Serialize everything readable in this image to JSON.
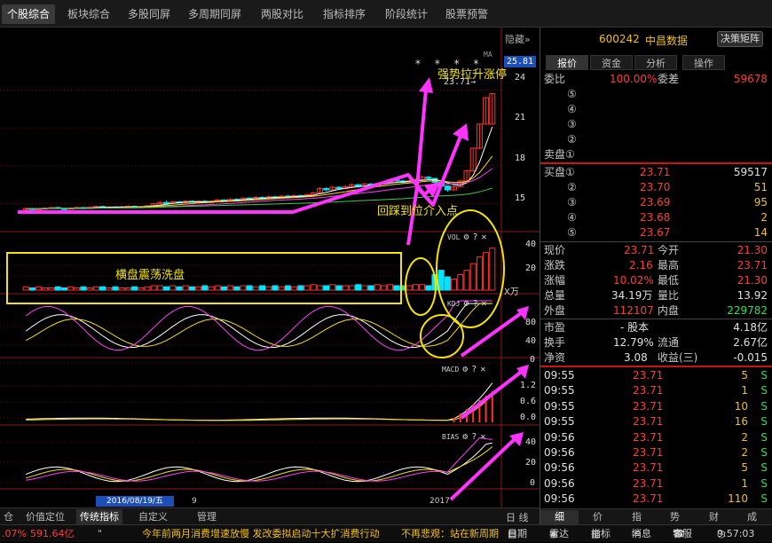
{
  "topnav": {
    "tabs": [
      "个股综合",
      "板块综合",
      "多股同屏",
      "多周期同屏",
      "两股对比",
      "指标排序",
      "阶段统计",
      "股票预警"
    ],
    "active_index": 0
  },
  "chart": {
    "hide_label": "隐藏»",
    "ma_label": "MA",
    "stars": "* * *   *",
    "high_marker": "23.71→",
    "current_price_tag": "25.81",
    "price_axis": [
      "24",
      "21",
      "18",
      "15"
    ],
    "vol_axis": [
      "40",
      "20"
    ],
    "vol_unit": "X万",
    "kdj_axis": [
      "80",
      "40",
      "0"
    ],
    "macd_axis": [
      "1.2",
      "0.6",
      "0.0"
    ],
    "bias_axis": [
      "40",
      "20",
      "0"
    ],
    "indicator_labels": {
      "vol": "VOL",
      "kdj": "KDJ",
      "macd": "MACD",
      "bias": "BIAS"
    },
    "indicator_icons": [
      "⚙",
      "?",
      "✕"
    ],
    "annotations": {
      "strong_rally": "强势拉升涨停",
      "pullback": "回踩到位介入点",
      "consolidation": "横盘震荡洗盘"
    },
    "date_highlight": "2016/08/19/五",
    "date_9": "9",
    "date_2017": "2017",
    "colors": {
      "up": "#ff3232",
      "down": "#00e5ff",
      "arrow": "#ff33ff",
      "annotation": "#f4e500"
    }
  },
  "chart_data": {
    "type": "candlestick",
    "price_ylim": [
      13.5,
      26
    ],
    "candles": [
      [
        14.55,
        14.62,
        14.65,
        14.5
      ],
      [
        14.62,
        14.58,
        14.68,
        14.55
      ],
      [
        14.58,
        14.6,
        14.65,
        14.52
      ],
      [
        14.6,
        14.66,
        14.7,
        14.55
      ],
      [
        14.66,
        14.7,
        14.75,
        14.6
      ],
      [
        14.7,
        14.62,
        14.75,
        14.58
      ],
      [
        14.62,
        14.58,
        14.68,
        14.5
      ],
      [
        14.58,
        14.64,
        14.7,
        14.55
      ],
      [
        14.64,
        14.7,
        14.78,
        14.6
      ],
      [
        14.7,
        14.66,
        14.75,
        14.6
      ],
      [
        14.66,
        14.72,
        14.8,
        14.6
      ],
      [
        14.72,
        14.78,
        14.85,
        14.68
      ],
      [
        14.78,
        14.72,
        14.85,
        14.66
      ],
      [
        14.72,
        14.75,
        14.82,
        14.68
      ],
      [
        14.75,
        14.7,
        14.8,
        14.64
      ],
      [
        14.7,
        14.76,
        14.82,
        14.66
      ],
      [
        14.76,
        14.8,
        14.88,
        14.72
      ],
      [
        14.8,
        14.74,
        14.86,
        14.7
      ],
      [
        14.74,
        14.78,
        14.84,
        14.7
      ],
      [
        14.78,
        14.84,
        14.9,
        14.74
      ],
      [
        14.84,
        15.0,
        15.05,
        14.8
      ],
      [
        15.0,
        15.1,
        15.2,
        14.95
      ],
      [
        15.1,
        15.05,
        15.25,
        15.0
      ],
      [
        15.05,
        15.15,
        15.2,
        15.0
      ],
      [
        15.15,
        15.1,
        15.22,
        15.05
      ],
      [
        15.1,
        15.2,
        15.3,
        15.05
      ],
      [
        15.2,
        15.15,
        15.28,
        15.1
      ],
      [
        15.15,
        15.2,
        15.3,
        15.1
      ],
      [
        15.2,
        15.1,
        15.3,
        15.05
      ],
      [
        15.1,
        15.2,
        15.25,
        15.05
      ],
      [
        15.2,
        15.3,
        15.4,
        15.15
      ],
      [
        15.3,
        15.25,
        15.35,
        15.2
      ],
      [
        15.25,
        15.35,
        15.45,
        15.2
      ],
      [
        15.35,
        15.3,
        15.45,
        15.25
      ],
      [
        15.3,
        15.45,
        15.5,
        15.25
      ],
      [
        15.45,
        15.4,
        15.5,
        15.35
      ],
      [
        15.4,
        15.5,
        15.6,
        15.35
      ],
      [
        15.5,
        15.45,
        15.6,
        15.4
      ],
      [
        15.45,
        15.55,
        15.65,
        15.4
      ],
      [
        15.55,
        15.5,
        15.62,
        15.45
      ],
      [
        15.5,
        15.6,
        15.7,
        15.45
      ],
      [
        15.6,
        15.55,
        15.7,
        15.5
      ],
      [
        15.55,
        15.65,
        15.75,
        15.5
      ],
      [
        15.65,
        15.6,
        15.72,
        15.55
      ],
      [
        15.6,
        15.7,
        15.8,
        15.55
      ],
      [
        15.7,
        15.85,
        15.95,
        15.65
      ],
      [
        15.85,
        16.2,
        16.3,
        15.8
      ],
      [
        16.2,
        16.1,
        16.3,
        16.0
      ],
      [
        16.1,
        16.3,
        16.4,
        16.05
      ],
      [
        16.3,
        16.2,
        16.4,
        16.1
      ],
      [
        16.2,
        16.35,
        16.45,
        16.15
      ],
      [
        16.35,
        16.5,
        16.6,
        16.3
      ],
      [
        16.5,
        16.4,
        16.6,
        16.35
      ],
      [
        16.4,
        16.55,
        16.65,
        16.35
      ],
      [
        16.55,
        16.45,
        16.65,
        16.4
      ],
      [
        16.45,
        16.6,
        16.7,
        16.4
      ],
      [
        16.6,
        16.7,
        16.8,
        16.55
      ],
      [
        16.7,
        16.9,
        17.0,
        16.65
      ],
      [
        16.9,
        16.8,
        17.0,
        16.75
      ],
      [
        16.8,
        16.7,
        16.9,
        16.6
      ],
      [
        16.7,
        16.8,
        16.9,
        16.65
      ],
      [
        16.8,
        16.9,
        17.0,
        16.75
      ],
      [
        16.9,
        17.1,
        17.2,
        16.85
      ],
      [
        17.1,
        17.0,
        17.2,
        16.9
      ],
      [
        17.0,
        16.7,
        17.05,
        16.5
      ],
      [
        16.7,
        16.4,
        16.75,
        16.3
      ],
      [
        16.4,
        16.1,
        16.45,
        15.95
      ],
      [
        16.1,
        16.35,
        16.45,
        16.0
      ],
      [
        16.35,
        16.8,
        16.9,
        16.3
      ],
      [
        16.8,
        17.6,
        17.7,
        16.75
      ],
      [
        17.6,
        19.4,
        19.4,
        17.55
      ],
      [
        19.4,
        21.3,
        21.3,
        19.3
      ],
      [
        21.3,
        23.4,
        23.4,
        21.3
      ],
      [
        21.3,
        23.71,
        23.71,
        21.3
      ]
    ],
    "volume": [
      3,
      2,
      3,
      2,
      2,
      3,
      2,
      3,
      2,
      3,
      2,
      3,
      3,
      2,
      3,
      2,
      2,
      3,
      2,
      3,
      4,
      4,
      3,
      4,
      3,
      4,
      3,
      3,
      4,
      3,
      4,
      3,
      4,
      3,
      4,
      4,
      3,
      4,
      3,
      4,
      3,
      4,
      3,
      4,
      4,
      5,
      4,
      4,
      5,
      4,
      4,
      4,
      5,
      4,
      4,
      5,
      4,
      5,
      4,
      4,
      4,
      5,
      5,
      4,
      14,
      18,
      12,
      10,
      14,
      18,
      24,
      30,
      34,
      38
    ],
    "vol_ylim": [
      0,
      45
    ]
  },
  "bottom_tabs": {
    "items": [
      "仓",
      "价值定位",
      "传统指标",
      "自定义",
      "管理"
    ],
    "active_index": 2,
    "scroll": "日 线"
  },
  "quote": {
    "code": "600242",
    "name": "中昌数据",
    "decision_btn": "决策矩阵",
    "subtabs": [
      "报价",
      "资金",
      "分析",
      "操作"
    ],
    "active_subtab": 0,
    "weibi_label": "委比",
    "weibi": "100.00%",
    "weicha_label": "委差",
    "weicha": "59678",
    "sell_labels": [
      "⑤",
      "④",
      "③",
      "②",
      "卖盘①"
    ],
    "buy": [
      {
        "label": "买盘①",
        "price": "23.71",
        "vol": "59517"
      },
      {
        "label": "②",
        "price": "23.70",
        "vol": "51"
      },
      {
        "label": "③",
        "price": "23.69",
        "vol": "95"
      },
      {
        "label": "④",
        "price": "23.68",
        "vol": "2"
      },
      {
        "label": "⑤",
        "price": "23.67",
        "vol": "14"
      }
    ],
    "stats": [
      {
        "l1": "现价",
        "v1": "23.71",
        "c1": "red",
        "l2": "今开",
        "v2": "21.30",
        "c2": "red"
      },
      {
        "l1": "涨跌",
        "v1": "2.16",
        "c1": "red",
        "l2": "最高",
        "v2": "23.71",
        "c2": "red"
      },
      {
        "l1": "涨幅",
        "v1": "10.02%",
        "c1": "red",
        "l2": "最低",
        "v2": "21.30",
        "c2": "red"
      },
      {
        "l1": "总量",
        "v1": "34.19万",
        "c1": "white",
        "l2": "量比",
        "v2": "13.92",
        "c2": "white"
      },
      {
        "l1": "外盘",
        "v1": "112107",
        "c1": "red",
        "l2": "内盘",
        "v2": "229782",
        "c2": "green"
      }
    ],
    "stats2": [
      {
        "l1": "市盈",
        "v1": "- 股本",
        "c1": "white",
        "l2": "",
        "v2": "4.18亿",
        "c2": "white"
      },
      {
        "l1": "换手",
        "v1": "12.79%",
        "c1": "white",
        "l2": "流通",
        "v2": "2.67亿",
        "c2": "white"
      },
      {
        "l1": "净资",
        "v1": "3.08",
        "c1": "white",
        "l2": "收益(三)",
        "v2": "-0.015",
        "c2": "white"
      }
    ],
    "ticks": [
      {
        "time": "09:55",
        "price": "23.71",
        "vol": "5",
        "side": "S"
      },
      {
        "time": "09:55",
        "price": "23.71",
        "vol": "1",
        "side": "S"
      },
      {
        "time": "09:55",
        "price": "23.71",
        "vol": "10",
        "side": "S"
      },
      {
        "time": "09:55",
        "price": "23.71",
        "vol": "16",
        "side": "S"
      },
      {
        "time": "09:56",
        "price": "23.71",
        "vol": "2",
        "side": "S"
      },
      {
        "time": "09:56",
        "price": "23.71",
        "vol": "2",
        "side": "S"
      },
      {
        "time": "09:56",
        "price": "23.71",
        "vol": "5",
        "side": "S"
      },
      {
        "time": "09:56",
        "price": "23.71",
        "vol": "1",
        "side": "S"
      },
      {
        "time": "09:56",
        "price": "23.71",
        "vol": "110",
        "side": "S"
      }
    ],
    "panel_tabs": [
      "细",
      "价",
      "指",
      "势",
      "财",
      "成"
    ],
    "active_panel_tab": 0
  },
  "status": {
    "left_pct": ".07%",
    "left_amount": "591.64亿",
    "quote_mark": "\"",
    "news": "今年前两月消费增速放慢 发改委拟启动十大扩消费行动",
    "news2": "不再悲观：站在新周期",
    "items": [
      "日期",
      "雷达",
      "指标",
      "消息",
      "客服"
    ],
    "time": "9:57:03"
  }
}
